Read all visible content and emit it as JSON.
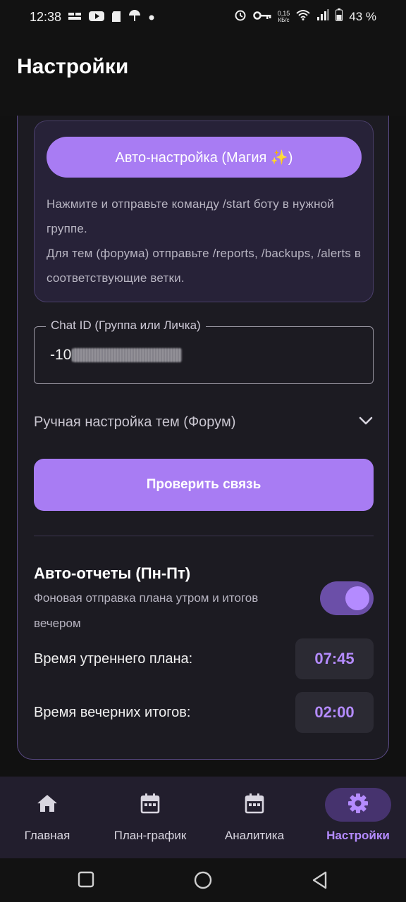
{
  "status_bar": {
    "time": "12:38",
    "network_speed_value": "0,15",
    "network_speed_unit": "КБ/с",
    "battery": "43 %",
    "icons": [
      "notification-icon",
      "youtube-icon",
      "sd-card-icon",
      "umbrella-icon",
      "dot-icon",
      "alarm-icon",
      "key-icon",
      "wifi-icon",
      "signal-icon",
      "battery-icon"
    ]
  },
  "header": {
    "title": "Настройки"
  },
  "auto_setup": {
    "button_label": "Авто-настройка (Магия ✨)",
    "help_line1": "Нажмите и отправьте команду /start боту в нужной группе.",
    "help_line2": "Для тем (форума) отправьте /reports, /backups, /alerts в соответствующие ветки."
  },
  "chat_id": {
    "label": "Chat ID (Группа или Личка)",
    "value": "-10"
  },
  "manual_topics": {
    "label": "Ручная настройка тем (Форум)"
  },
  "check_connection": {
    "label": "Проверить связь"
  },
  "auto_reports": {
    "title": "Авто-отчеты (Пн-Пт)",
    "description": "Фоновая отправка плана утром и итогов вечером",
    "enabled": true,
    "morning_label": "Время утреннего плана:",
    "morning_time": "07:45",
    "evening_label": "Время вечерних итогов:",
    "evening_time": "02:00"
  },
  "bottom_nav": {
    "items": [
      {
        "label": "Главная",
        "icon": "home-icon"
      },
      {
        "label": "План-график",
        "icon": "calendar-icon"
      },
      {
        "label": "Аналитика",
        "icon": "calendar-icon"
      },
      {
        "label": "Настройки",
        "icon": "gear-icon",
        "active": true
      }
    ]
  },
  "colors": {
    "accent": "#a87cf3",
    "accent_light": "#b48bff",
    "card_bg": "#1c1b22",
    "card_border": "#5a4a85",
    "nav_bg": "#221e2d"
  }
}
